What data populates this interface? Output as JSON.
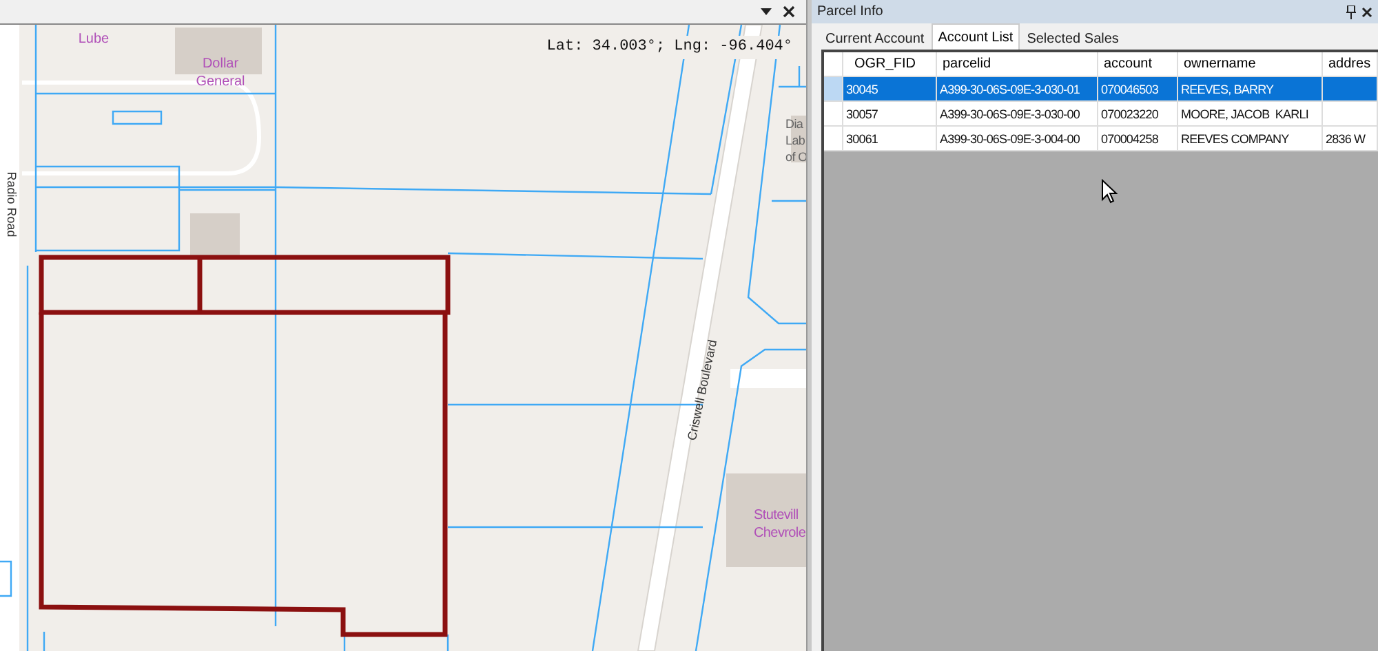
{
  "map": {
    "coordinates": "Lat: 34.003°; Lng: -96.404°",
    "labels": [
      {
        "kind": "poi",
        "text": "Lube"
      },
      {
        "kind": "poi",
        "text": "Dollar General"
      },
      {
        "kind": "building",
        "text": "Dia Lab of O"
      },
      {
        "kind": "road",
        "text": "Radio Road"
      },
      {
        "kind": "road",
        "text": "Criswell Boulevard"
      },
      {
        "kind": "poi",
        "text": "Stutevill Chevrole"
      }
    ]
  },
  "panel": {
    "title": "Parcel Info",
    "tabs": [
      {
        "label": "Current Account",
        "selected": false
      },
      {
        "label": "Account List",
        "selected": true
      },
      {
        "label": "Selected Sales",
        "selected": false
      }
    ],
    "table": {
      "columns": [
        "OGR_FID",
        "parcelid",
        "account",
        "ownername",
        "addres"
      ],
      "rows": [
        {
          "selected": true,
          "cells": [
            "30045",
            "A399-30-06S-09E-3-030-01",
            "070046503",
            "REEVES, BARRY",
            ""
          ]
        },
        {
          "selected": false,
          "cells": [
            "30057",
            "A399-30-06S-09E-3-030-00",
            "070023220",
            "MOORE, JACOB  KARLI",
            ""
          ]
        },
        {
          "selected": false,
          "cells": [
            "30061",
            "A399-30-06S-09E-3-004-00",
            "070004258",
            "REEVES COMPANY",
            "2836 W"
          ]
        }
      ]
    }
  }
}
